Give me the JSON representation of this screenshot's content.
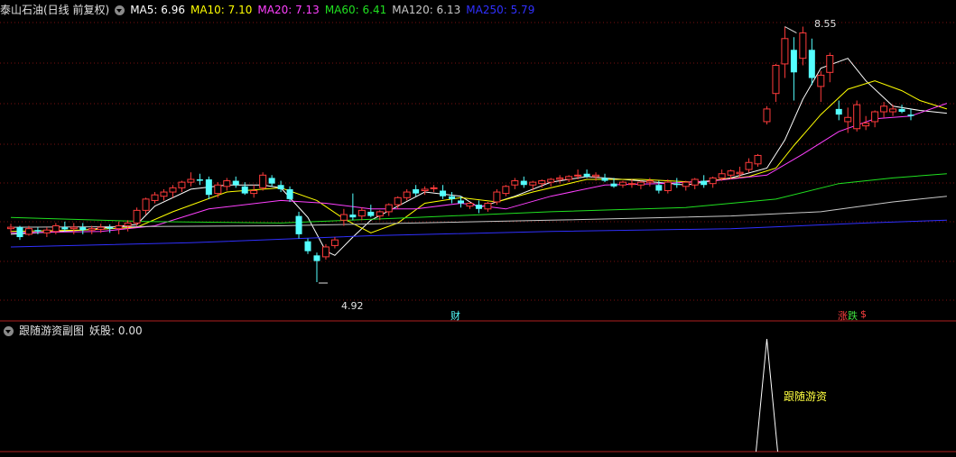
{
  "header": {
    "stock_title": "泰山石油(日线 前复权)",
    "ma_items": [
      {
        "text": "MA5: 6.96",
        "color": "#ffffff"
      },
      {
        "text": "MA10: 7.10",
        "color": "#ffff00"
      },
      {
        "text": "MA20: 7.13",
        "color": "#ff40ff"
      },
      {
        "text": "MA60: 6.41",
        "color": "#20e020"
      },
      {
        "text": "MA120: 6.13",
        "color": "#c8c8c8"
      },
      {
        "text": "MA250: 5.79",
        "color": "#3030ff"
      }
    ]
  },
  "sub_header": {
    "title": "跟随游资副图",
    "value_text": "妖股: 0.00"
  },
  "markers": {
    "high": "8.55",
    "low": "4.92",
    "finance": "财",
    "up": "涨",
    "down": "跌",
    "dollar": "$",
    "signal_label": "跟随游资"
  },
  "colors": {
    "up": "#ff3b3b",
    "down": "#54ffff",
    "grid": "#7a1010",
    "axis": "#b02020"
  },
  "chart_data": {
    "type": "candlestick",
    "price_range": [
      4.6,
      8.8
    ],
    "candles": [
      [
        5.68,
        5.75,
        5.62,
        5.7
      ],
      [
        5.7,
        5.72,
        5.52,
        5.56
      ],
      [
        5.6,
        5.72,
        5.58,
        5.68
      ],
      [
        5.66,
        5.7,
        5.6,
        5.64
      ],
      [
        5.62,
        5.7,
        5.56,
        5.66
      ],
      [
        5.64,
        5.76,
        5.6,
        5.72
      ],
      [
        5.7,
        5.78,
        5.64,
        5.67
      ],
      [
        5.68,
        5.76,
        5.6,
        5.7
      ],
      [
        5.7,
        5.76,
        5.6,
        5.66
      ],
      [
        5.66,
        5.72,
        5.6,
        5.68
      ],
      [
        5.67,
        5.75,
        5.62,
        5.7
      ],
      [
        5.7,
        5.74,
        5.62,
        5.68
      ],
      [
        5.68,
        5.78,
        5.6,
        5.72
      ],
      [
        5.72,
        5.8,
        5.64,
        5.76
      ],
      [
        5.76,
        5.98,
        5.72,
        5.94
      ],
      [
        5.94,
        6.12,
        5.88,
        6.1
      ],
      [
        6.08,
        6.2,
        6.04,
        6.16
      ],
      [
        6.14,
        6.24,
        6.08,
        6.2
      ],
      [
        6.2,
        6.3,
        6.12,
        6.26
      ],
      [
        6.26,
        6.36,
        6.2,
        6.34
      ],
      [
        6.34,
        6.48,
        6.28,
        6.38
      ],
      [
        6.38,
        6.46,
        6.3,
        6.36
      ],
      [
        6.38,
        6.42,
        6.1,
        6.16
      ],
      [
        6.18,
        6.34,
        6.12,
        6.3
      ],
      [
        6.28,
        6.4,
        6.22,
        6.36
      ],
      [
        6.36,
        6.42,
        6.26,
        6.3
      ],
      [
        6.28,
        6.34,
        6.16,
        6.18
      ],
      [
        6.18,
        6.3,
        6.12,
        6.22
      ],
      [
        6.26,
        6.48,
        6.22,
        6.44
      ],
      [
        6.4,
        6.44,
        6.28,
        6.32
      ],
      [
        6.3,
        6.36,
        6.2,
        6.24
      ],
      [
        6.24,
        6.28,
        6.06,
        6.1
      ],
      [
        5.86,
        5.92,
        5.54,
        5.6
      ],
      [
        5.5,
        5.54,
        5.32,
        5.36
      ],
      [
        5.3,
        5.34,
        4.92,
        5.22
      ],
      [
        5.28,
        5.46,
        5.24,
        5.42
      ],
      [
        5.44,
        5.56,
        5.4,
        5.52
      ],
      [
        5.8,
        5.96,
        5.72,
        5.88
      ],
      [
        5.88,
        6.18,
        5.8,
        5.84
      ],
      [
        5.86,
        5.98,
        5.8,
        5.94
      ],
      [
        5.92,
        6.02,
        5.84,
        5.86
      ],
      [
        5.86,
        5.94,
        5.8,
        5.92
      ],
      [
        5.92,
        6.04,
        5.86,
        6.02
      ],
      [
        6.02,
        6.14,
        5.96,
        6.12
      ],
      [
        6.12,
        6.24,
        6.08,
        6.2
      ],
      [
        6.24,
        6.3,
        6.14,
        6.18
      ],
      [
        6.22,
        6.28,
        6.16,
        6.24
      ],
      [
        6.26,
        6.3,
        6.2,
        6.26
      ],
      [
        6.22,
        6.3,
        6.1,
        6.14
      ],
      [
        6.14,
        6.2,
        6.04,
        6.1
      ],
      [
        6.08,
        6.14,
        5.98,
        6.04
      ],
      [
        6.0,
        6.06,
        5.96,
        6.04
      ],
      [
        6.02,
        6.08,
        5.9,
        5.96
      ],
      [
        5.96,
        6.06,
        5.92,
        6.04
      ],
      [
        6.06,
        6.24,
        6.02,
        6.2
      ],
      [
        6.18,
        6.3,
        6.14,
        6.28
      ],
      [
        6.3,
        6.4,
        6.24,
        6.36
      ],
      [
        6.36,
        6.42,
        6.26,
        6.3
      ],
      [
        6.3,
        6.36,
        6.22,
        6.34
      ],
      [
        6.32,
        6.38,
        6.26,
        6.36
      ],
      [
        6.34,
        6.4,
        6.28,
        6.38
      ],
      [
        6.38,
        6.44,
        6.32,
        6.4
      ],
      [
        6.38,
        6.44,
        6.34,
        6.42
      ],
      [
        6.44,
        6.52,
        6.38,
        6.44
      ],
      [
        6.46,
        6.52,
        6.4,
        6.42
      ],
      [
        6.42,
        6.48,
        6.36,
        6.44
      ],
      [
        6.4,
        6.46,
        6.34,
        6.36
      ],
      [
        6.32,
        6.4,
        6.26,
        6.28
      ],
      [
        6.3,
        6.36,
        6.26,
        6.34
      ],
      [
        6.32,
        6.38,
        6.26,
        6.32
      ],
      [
        6.3,
        6.36,
        6.24,
        6.34
      ],
      [
        6.34,
        6.4,
        6.28,
        6.36
      ],
      [
        6.3,
        6.36,
        6.18,
        6.22
      ],
      [
        6.22,
        6.38,
        6.18,
        6.34
      ],
      [
        6.32,
        6.4,
        6.26,
        6.3
      ],
      [
        6.28,
        6.36,
        6.22,
        6.34
      ],
      [
        6.3,
        6.4,
        6.24,
        6.38
      ],
      [
        6.36,
        6.44,
        6.26,
        6.3
      ],
      [
        6.32,
        6.42,
        6.26,
        6.4
      ],
      [
        6.4,
        6.52,
        6.36,
        6.46
      ],
      [
        6.44,
        6.52,
        6.38,
        6.5
      ],
      [
        6.46,
        6.56,
        6.4,
        6.48
      ],
      [
        6.52,
        6.68,
        6.48,
        6.62
      ],
      [
        6.6,
        6.74,
        6.56,
        6.72
      ],
      [
        7.2,
        7.42,
        7.16,
        7.38
      ],
      [
        7.6,
        8.02,
        7.48,
        8.0
      ],
      [
        8.02,
        8.55,
        7.82,
        8.38
      ],
      [
        8.22,
        8.4,
        7.5,
        7.9
      ],
      [
        8.1,
        8.55,
        8.0,
        8.46
      ],
      [
        8.22,
        8.38,
        7.72,
        7.82
      ],
      [
        7.7,
        7.92,
        7.48,
        7.86
      ],
      [
        7.9,
        8.18,
        7.76,
        8.14
      ],
      [
        7.38,
        7.5,
        7.22,
        7.3
      ],
      [
        7.2,
        7.4,
        7.04,
        7.26
      ],
      [
        7.1,
        7.5,
        7.06,
        7.44
      ],
      [
        7.14,
        7.28,
        7.08,
        7.18
      ],
      [
        7.2,
        7.36,
        7.12,
        7.34
      ],
      [
        7.34,
        7.48,
        7.26,
        7.42
      ],
      [
        7.34,
        7.44,
        7.28,
        7.38
      ],
      [
        7.38,
        7.44,
        7.32,
        7.34
      ],
      [
        7.3,
        7.38,
        7.22,
        7.28
      ]
    ],
    "ma_series": [
      {
        "name": "MA5",
        "color": "#ffffff",
        "values": [
          [
            0,
            5.6
          ],
          [
            8,
            5.66
          ],
          [
            14,
            5.74
          ],
          [
            16,
            6.0
          ],
          [
            20,
            6.24
          ],
          [
            24,
            6.3
          ],
          [
            28,
            6.3
          ],
          [
            30,
            6.26
          ],
          [
            33,
            5.84
          ],
          [
            35,
            5.36
          ],
          [
            36,
            5.3
          ],
          [
            38,
            5.56
          ],
          [
            40,
            5.8
          ],
          [
            43,
            6.0
          ],
          [
            46,
            6.2
          ],
          [
            50,
            6.14
          ],
          [
            52,
            5.98
          ],
          [
            56,
            6.14
          ],
          [
            60,
            6.34
          ],
          [
            64,
            6.42
          ],
          [
            70,
            6.36
          ],
          [
            75,
            6.3
          ],
          [
            80,
            6.4
          ],
          [
            84,
            6.54
          ],
          [
            86,
            6.94
          ],
          [
            88,
            7.52
          ],
          [
            90,
            7.96
          ],
          [
            93,
            8.1
          ],
          [
            95,
            7.78
          ],
          [
            98,
            7.42
          ],
          [
            101,
            7.36
          ],
          [
            104,
            7.32
          ]
        ]
      },
      {
        "name": "MA10",
        "color": "#ffff00",
        "values": [
          [
            0,
            5.64
          ],
          [
            8,
            5.66
          ],
          [
            14,
            5.7
          ],
          [
            18,
            5.92
          ],
          [
            24,
            6.2
          ],
          [
            30,
            6.26
          ],
          [
            34,
            6.08
          ],
          [
            37,
            5.82
          ],
          [
            40,
            5.62
          ],
          [
            43,
            5.76
          ],
          [
            46,
            6.04
          ],
          [
            50,
            6.12
          ],
          [
            54,
            6.06
          ],
          [
            58,
            6.2
          ],
          [
            64,
            6.38
          ],
          [
            70,
            6.38
          ],
          [
            76,
            6.34
          ],
          [
            82,
            6.42
          ],
          [
            85,
            6.54
          ],
          [
            87,
            6.86
          ],
          [
            90,
            7.3
          ],
          [
            93,
            7.66
          ],
          [
            96,
            7.78
          ],
          [
            99,
            7.64
          ],
          [
            101,
            7.5
          ],
          [
            104,
            7.38
          ]
        ]
      },
      {
        "name": "MA20",
        "color": "#ff40ff",
        "values": [
          [
            0,
            5.62
          ],
          [
            10,
            5.64
          ],
          [
            16,
            5.72
          ],
          [
            22,
            5.96
          ],
          [
            30,
            6.08
          ],
          [
            35,
            6.04
          ],
          [
            40,
            5.96
          ],
          [
            45,
            5.96
          ],
          [
            50,
            6.04
          ],
          [
            55,
            5.96
          ],
          [
            60,
            6.14
          ],
          [
            66,
            6.3
          ],
          [
            72,
            6.32
          ],
          [
            78,
            6.36
          ],
          [
            84,
            6.44
          ],
          [
            88,
            6.74
          ],
          [
            92,
            7.06
          ],
          [
            96,
            7.24
          ],
          [
            100,
            7.28
          ],
          [
            104,
            7.46
          ]
        ]
      },
      {
        "name": "MA60",
        "color": "#20e020",
        "values": [
          [
            0,
            5.84
          ],
          [
            15,
            5.78
          ],
          [
            30,
            5.76
          ],
          [
            45,
            5.84
          ],
          [
            60,
            5.92
          ],
          [
            75,
            5.98
          ],
          [
            85,
            6.1
          ],
          [
            92,
            6.32
          ],
          [
            98,
            6.4
          ],
          [
            104,
            6.46
          ]
        ]
      },
      {
        "name": "MA120",
        "color": "#c8c8c8",
        "values": [
          [
            0,
            5.7
          ],
          [
            30,
            5.72
          ],
          [
            60,
            5.8
          ],
          [
            80,
            5.86
          ],
          [
            90,
            5.92
          ],
          [
            98,
            6.06
          ],
          [
            104,
            6.14
          ]
        ]
      },
      {
        "name": "MA250",
        "color": "#3030ff",
        "values": [
          [
            0,
            5.42
          ],
          [
            20,
            5.48
          ],
          [
            40,
            5.58
          ],
          [
            60,
            5.64
          ],
          [
            80,
            5.68
          ],
          [
            95,
            5.76
          ],
          [
            104,
            5.8
          ]
        ]
      }
    ],
    "signal": {
      "index": 84,
      "value": 1,
      "label": "跟随游资"
    }
  }
}
